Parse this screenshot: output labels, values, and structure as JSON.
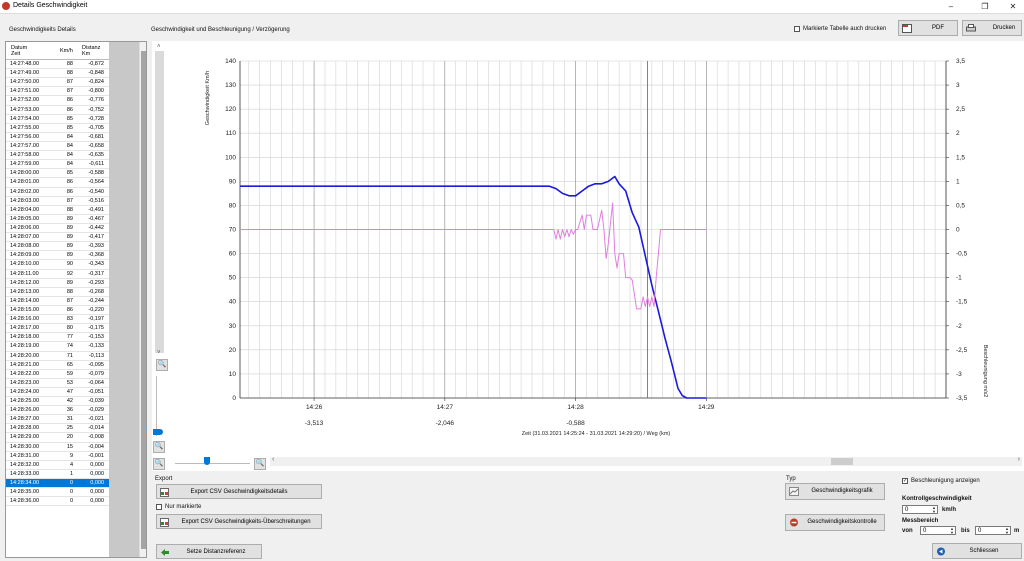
{
  "window": {
    "title": "Details Geschwindigkeit",
    "minimize": "–",
    "maximize": "❐",
    "close": "✕"
  },
  "left_panel": {
    "title": "Geschwindigkeits Details",
    "columns": {
      "date_line1": "Datum",
      "date_line2": "Zeit",
      "kmh": "Km/h",
      "dist_line1": "Distanz",
      "dist_line2": "Km"
    },
    "rows": [
      [
        "14:27:48.00",
        "88",
        "-0,872"
      ],
      [
        "14:27:49.00",
        "88",
        "-0,848"
      ],
      [
        "14:27:50.00",
        "87",
        "-0,824"
      ],
      [
        "14:27:51.00",
        "87",
        "-0,800"
      ],
      [
        "14:27:52.00",
        "86",
        "-0,776"
      ],
      [
        "14:27:53.00",
        "86",
        "-0,752"
      ],
      [
        "14:27:54.00",
        "85",
        "-0,728"
      ],
      [
        "14:27:55.00",
        "85",
        "-0,705"
      ],
      [
        "14:27:56.00",
        "84",
        "-0,681"
      ],
      [
        "14:27:57.00",
        "84",
        "-0,658"
      ],
      [
        "14:27:58.00",
        "84",
        "-0,635"
      ],
      [
        "14:27:59.00",
        "84",
        "-0,611"
      ],
      [
        "14:28:00.00",
        "85",
        "-0,588"
      ],
      [
        "14:28:01.00",
        "86",
        "-0,564"
      ],
      [
        "14:28:02.00",
        "86",
        "-0,540"
      ],
      [
        "14:28:03.00",
        "87",
        "-0,516"
      ],
      [
        "14:28:04.00",
        "88",
        "-0,491"
      ],
      [
        "14:28:05.00",
        "89",
        "-0,467"
      ],
      [
        "14:28:06.00",
        "89",
        "-0,442"
      ],
      [
        "14:28:07.00",
        "89",
        "-0,417"
      ],
      [
        "14:28:08.00",
        "89",
        "-0,393"
      ],
      [
        "14:28:09.00",
        "89",
        "-0,368"
      ],
      [
        "14:28:10.00",
        "90",
        "-0,343"
      ],
      [
        "14:28:11.00",
        "92",
        "-0,317"
      ],
      [
        "14:28:12.00",
        "89",
        "-0,293"
      ],
      [
        "14:28:13.00",
        "88",
        "-0,268"
      ],
      [
        "14:28:14.00",
        "87",
        "-0,244"
      ],
      [
        "14:28:15.00",
        "86",
        "-0,220"
      ],
      [
        "14:28:16.00",
        "83",
        "-0,197"
      ],
      [
        "14:28:17.00",
        "80",
        "-0,175"
      ],
      [
        "14:28:18.00",
        "77",
        "-0,153"
      ],
      [
        "14:28:19.00",
        "74",
        "-0,133"
      ],
      [
        "14:28:20.00",
        "71",
        "-0,113"
      ],
      [
        "14:28:21.00",
        "65",
        "-0,095"
      ],
      [
        "14:28:22.00",
        "59",
        "-0,079"
      ],
      [
        "14:28:23.00",
        "53",
        "-0,064"
      ],
      [
        "14:28:24.00",
        "47",
        "-0,051"
      ],
      [
        "14:28:25.00",
        "42",
        "-0,039"
      ],
      [
        "14:28:26.00",
        "36",
        "-0,029"
      ],
      [
        "14:28:27.00",
        "31",
        "-0,021"
      ],
      [
        "14:28:28.00",
        "25",
        "-0,014"
      ],
      [
        "14:28:29.00",
        "20",
        "-0,008"
      ],
      [
        "14:28:30.00",
        "15",
        "-0,004"
      ],
      [
        "14:28:31.00",
        "9",
        "-0,001"
      ],
      [
        "14:28:32.00",
        "4",
        "0,000"
      ],
      [
        "14:28:33.00",
        "1",
        "0,000"
      ],
      [
        "14:28:34.00",
        "0",
        "0,000"
      ],
      [
        "14:28:35.00",
        "0",
        "0,000"
      ],
      [
        "14:28:36.00",
        "0",
        "0,000"
      ]
    ],
    "selected_index": 46
  },
  "chart_panel": {
    "title": "Geschwindigkeit und Beschleunigung / Verzögerung"
  },
  "toolbar": {
    "print_marked_label": "Markierte Tabelle auch drucken",
    "print_marked_checked": false,
    "pdf_label": "PDF",
    "print_label": "Drucken"
  },
  "chart_data": {
    "type": "line",
    "ylabel": "Geschwindigkeit Km/h",
    "y2label": "Beschleunigung m/s2",
    "xlabel": "Zeit (31.03.2021 14:25:24 - 31.03.2021 14:29:20) /  Weg (km)",
    "ylim": [
      0,
      140
    ],
    "y2lim": [
      -3.5,
      3.5
    ],
    "y_ticks": [
      "0",
      "10",
      "20",
      "30",
      "40",
      "50",
      "60",
      "70",
      "80",
      "90",
      "100",
      "110",
      "120",
      "130",
      "140"
    ],
    "y2_ticks": [
      "-3,5",
      "-3",
      "-2,5",
      "-2",
      "-1,5",
      "-1",
      "-0,5",
      "0",
      "0,5",
      "1",
      "1,5",
      "2",
      "2,5",
      "3",
      "3,5"
    ],
    "y2_tick_values": [
      -3.5,
      -3,
      -2.5,
      -2,
      -1.5,
      -1,
      -0.5,
      0,
      0.5,
      1,
      1.5,
      2,
      2.5,
      3,
      3.5
    ],
    "x_range_s": [
      -214,
      110
    ],
    "time_ticks": [
      {
        "t": -180,
        "label": "14:26",
        "dist": "-3,513"
      },
      {
        "t": -120,
        "label": "14:27",
        "dist": "-2,046"
      },
      {
        "t": -60,
        "label": "14:28",
        "dist": "-0,588"
      },
      {
        "t": 0,
        "label": "14:29",
        "dist": ""
      }
    ],
    "grid": true,
    "marker_t": -27,
    "series": [
      {
        "color": "#1a1adc",
        "points": [
          [
            -214,
            88
          ],
          [
            -72,
            88
          ],
          [
            -69,
            87
          ],
          [
            -66,
            85
          ],
          [
            -63,
            84
          ],
          [
            -60,
            84
          ],
          [
            -57,
            86
          ],
          [
            -54,
            88
          ],
          [
            -51,
            89
          ],
          [
            -48,
            89
          ],
          [
            -45,
            90
          ],
          [
            -42,
            92
          ],
          [
            -40,
            89
          ],
          [
            -37,
            86
          ],
          [
            -34,
            77
          ],
          [
            -31,
            71
          ],
          [
            -28,
            59
          ],
          [
            -25,
            47
          ],
          [
            -22,
            36
          ],
          [
            -19,
            25
          ],
          [
            -16,
            15
          ],
          [
            -13,
            4
          ],
          [
            -11,
            1
          ],
          [
            -9,
            0
          ],
          [
            0,
            0
          ]
        ]
      },
      {
        "axis": "y2",
        "color": "#e07fe0",
        "points": [
          [
            -214,
            0
          ],
          [
            -70,
            0
          ],
          [
            -69,
            -0.2
          ],
          [
            -68,
            0
          ],
          [
            -67,
            -0.2
          ],
          [
            -66,
            0
          ],
          [
            -65,
            -0.15
          ],
          [
            -64,
            0
          ],
          [
            -63,
            -0.15
          ],
          [
            -62,
            0
          ],
          [
            -61,
            -0.1
          ],
          [
            -60,
            0
          ],
          [
            -59,
            0
          ],
          [
            -57,
            0.3
          ],
          [
            -56,
            0
          ],
          [
            -55,
            0.3
          ],
          [
            -53,
            0.3
          ],
          [
            -52,
            0
          ],
          [
            -51,
            0
          ],
          [
            -50,
            0
          ],
          [
            -48,
            0.4
          ],
          [
            -47,
            0
          ],
          [
            -46,
            -0.6
          ],
          [
            -45,
            -0.3
          ],
          [
            -43,
            0.55
          ],
          [
            -42,
            -0.5
          ],
          [
            -41,
            -0.8
          ],
          [
            -40,
            -0.5
          ],
          [
            -38,
            -0.5
          ],
          [
            -37,
            -1
          ],
          [
            -35,
            -1
          ],
          [
            -34,
            -1.05
          ],
          [
            -32,
            -1.65
          ],
          [
            -30,
            -1.65
          ],
          [
            -29,
            -1.4
          ],
          [
            -28,
            -1.6
          ],
          [
            -27,
            -1.4
          ],
          [
            -26,
            -1.6
          ],
          [
            -25,
            -1.4
          ],
          [
            -24,
            -1.6
          ],
          [
            -23,
            -1.0
          ],
          [
            -22,
            -0.5
          ],
          [
            -21,
            0
          ],
          [
            0,
            0
          ]
        ]
      }
    ]
  },
  "export": {
    "title": "Export",
    "csv_details_label": "Export CSV Geschwindigkeitsdetails",
    "only_marked_label": "Nur markierte",
    "only_marked_checked": false,
    "csv_exceed_label": "Export CSV Geschwindigkeits-Überschreitungen",
    "reference_label": "Setze Distanzreferenz"
  },
  "type_box": {
    "title": "Typ",
    "graphic_label": "Geschwindigkeitsgrafik",
    "control_label": "Geschwindigkeitskontrolle"
  },
  "settings": {
    "accel_label": "Beschleunigung anzeigen",
    "accel_checked": true,
    "control_speed_label": "Kontrollgeschwindigkeit",
    "control_speed_value": "0",
    "control_speed_unit": "km/h",
    "range_label": "Messbereich",
    "from_label": "von",
    "from_value": "0",
    "to_label": "bis",
    "to_value": "0",
    "range_unit": "m"
  },
  "close_label": "Schliessen"
}
